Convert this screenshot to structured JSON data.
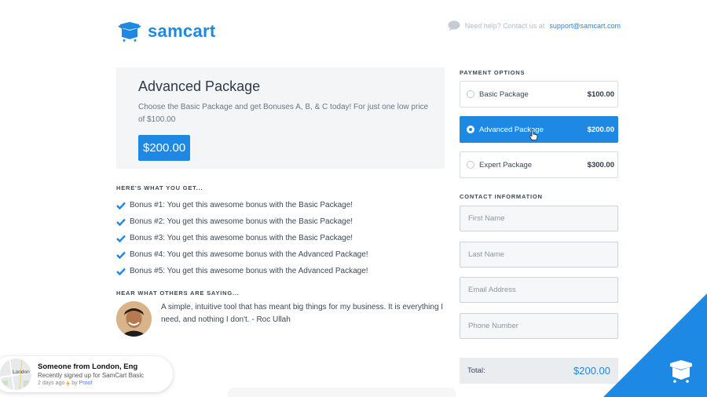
{
  "header": {
    "logo_text": "samcart",
    "help_text": "Need help? Contact us at",
    "help_email": "support@samcart.com"
  },
  "package": {
    "title": "Advanced Package",
    "description": "Choose the Basic Package and get Bonuses A, B, & C today! For just one low price of $100.00",
    "price": "$200.00"
  },
  "bonuses": {
    "label": "HERE'S WHAT YOU GET...",
    "items": [
      "Bonus #1: You get this awesome bonus with the Basic Package!",
      "Bonus #2: You get this awesome bonus with the Basic Package!",
      "Bonus #3: You get this awesome bonus with the Basic Package!",
      "Bonus #4: You get this awesome bonus with the Advanced Package!",
      "Bonus #5: You get this awesome bonus with the Advanced Package!"
    ]
  },
  "testimonial": {
    "label": "HEAR WHAT OTHERS ARE SAYING...",
    "quote": "A simple, intuitive tool that has meant big things for my business. It is everything I need, and nothing I don't. - Roc Ullah"
  },
  "payment": {
    "label": "PAYMENT OPTIONS",
    "options": [
      {
        "name": "Basic Package",
        "price": "$100.00"
      },
      {
        "name": "Advanced Package",
        "price": "$200.00"
      },
      {
        "name": "Expert Package",
        "price": "$300.00"
      }
    ],
    "selected": 1
  },
  "contact": {
    "label": "CONTACT INFORMATION",
    "first_name_placeholder": "First Name",
    "last_name_placeholder": "Last Name",
    "email_placeholder": "Email Address",
    "phone_placeholder": "Phone Number"
  },
  "total": {
    "label": "Total:",
    "amount": "$200.00"
  },
  "notification": {
    "map_label": "London",
    "title": "Someone from London, Eng",
    "subtitle": "Recently signed up for SamCart Basic",
    "time": "2 days ago",
    "by": "by",
    "brand": "Proof"
  },
  "colors": {
    "accent": "#1e88e5",
    "panel": "#f3f5f7"
  }
}
